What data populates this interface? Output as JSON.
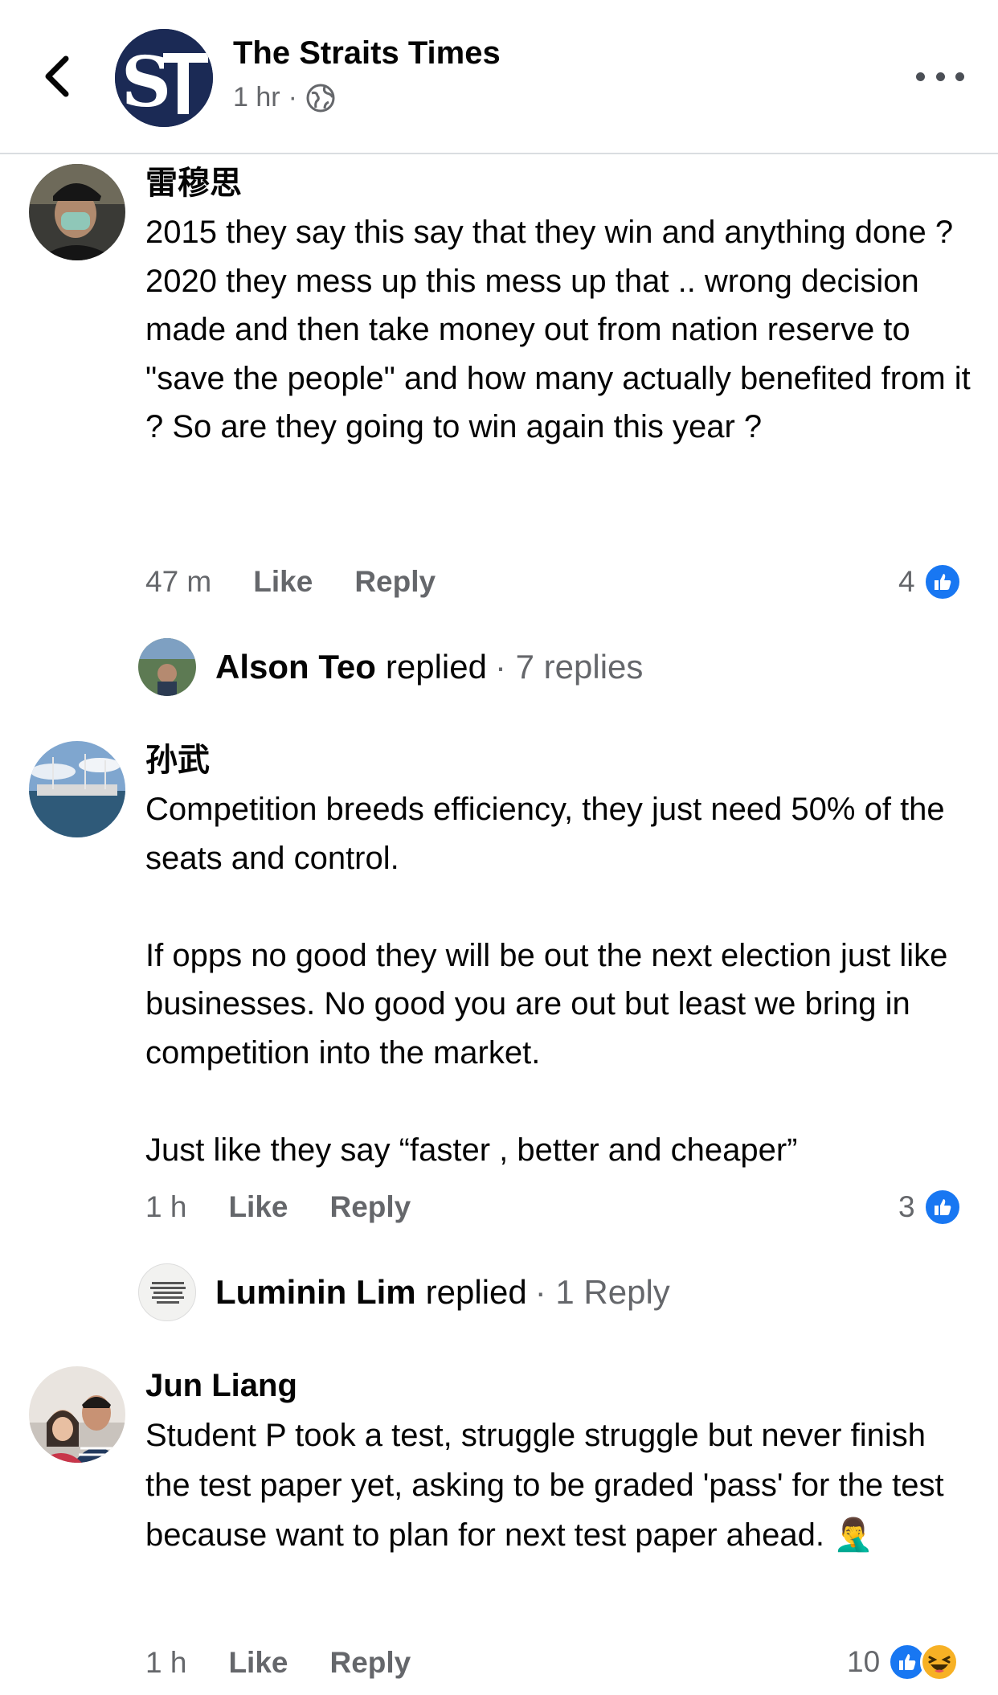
{
  "header": {
    "back_icon": "chevron-left-icon",
    "page_name": "The Straits Times",
    "page_logo_text": "ST",
    "time": "1 hr",
    "separator": "·",
    "audience_icon": "globe-icon",
    "more_icon": "more-horizontal-icon"
  },
  "comments": [
    {
      "author": "雷穆思",
      "text": "2015 they say this say that they win and anything done ?\n2020 they mess up this mess up that .. wrong decision made and then take money out from nation reserve to \"save the people\" and how many actually benefited from it ? So are they going to win again this year ?",
      "time": "47 m",
      "like_label": "Like",
      "reply_label": "Reply",
      "reaction_count": "4",
      "reactions": [
        "like-icon"
      ],
      "reply_summary": {
        "name": "Alson Teo",
        "verb": "replied",
        "count": "· 7 replies"
      }
    },
    {
      "author": "孙武",
      "text": "Competition breeds efficiency, they just need 50% of the seats and control.\n\nIf opps no good they will be out the next election just like businesses. No good you are out but least we bring in competition into the market.\n\nJust like they say “faster , better and cheaper”",
      "time": "1 h",
      "like_label": "Like",
      "reply_label": "Reply",
      "reaction_count": "3",
      "reactions": [
        "like-icon"
      ],
      "reply_summary": {
        "name": "Luminin Lim",
        "verb": "replied",
        "count": "· 1 Reply"
      }
    },
    {
      "author": "Jun Liang",
      "text": "Student P took a test, struggle struggle but never finish the test paper yet, asking to be graded 'pass' for the test because want to plan for next test paper ahead. 🤦‍♂️",
      "time": "1 h",
      "like_label": "Like",
      "reply_label": "Reply",
      "reaction_count": "10",
      "reactions": [
        "like-icon",
        "haha-icon"
      ]
    }
  ],
  "colors": {
    "accent": "#1877f2",
    "secondary_text": "#65676b",
    "haha": "#f7b125"
  }
}
